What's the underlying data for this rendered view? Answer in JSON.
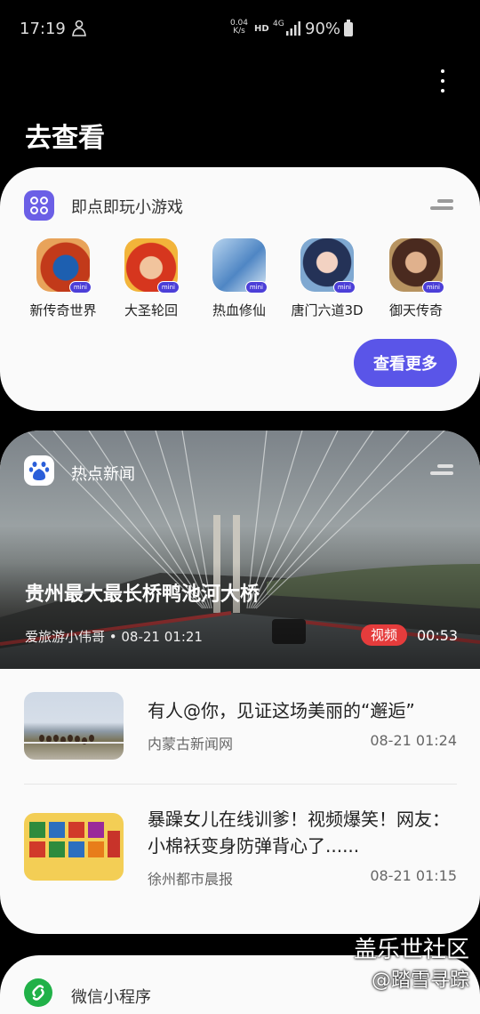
{
  "status_bar": {
    "time": "17:19",
    "net_speed_value": "0.04",
    "net_speed_unit": "K/s",
    "hd": "HD",
    "network": "4G",
    "battery": "90%"
  },
  "page": {
    "title": "去查看"
  },
  "games": {
    "header": "即点即玩小游戏",
    "badge": "mini",
    "items": [
      {
        "name": "新传奇世界"
      },
      {
        "name": "大圣轮回"
      },
      {
        "name": "热血修仙"
      },
      {
        "name": "唐门六道3D"
      },
      {
        "name": "御天传奇"
      }
    ],
    "more_label": "查看更多",
    "accent": "#5a55e8"
  },
  "news": {
    "header": "热点新闻",
    "hero": {
      "title": "贵州最大最长桥鸭池河大桥",
      "meta": "爱旅游小伟哥 • 08-21 01:21",
      "badge": "视频",
      "duration": "00:53"
    },
    "items": [
      {
        "title": "有人@你，见证这场美丽的“邂逅”",
        "source": "内蒙古新闻网",
        "time": "08-21 01:24"
      },
      {
        "title": "暴躁女儿在线训爹！视频爆笑！网友：小棉袄变身防弹背心了......",
        "source": "徐州都市晨报",
        "time": "08-21 01:15"
      }
    ],
    "badge_color": "#e53c3c"
  },
  "mini_programs": {
    "header": "微信小程序"
  },
  "watermark": {
    "line1": "盖乐世社区",
    "line2": "@踏雪寻踪"
  }
}
